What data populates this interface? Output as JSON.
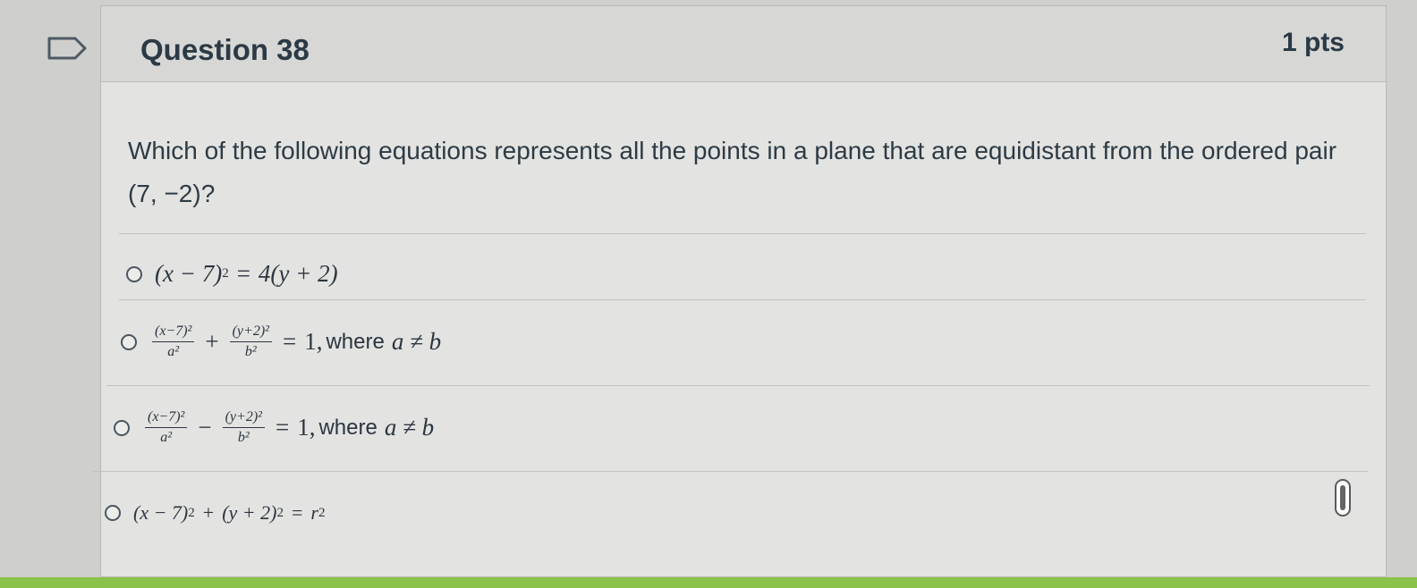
{
  "question": {
    "title": "Question 38",
    "points": "1 pts",
    "text": "Which of the following equations represents all the points in a plane that are equidistant from the ordered pair (7, −2)?"
  },
  "answers": [
    {
      "lhs": "(x − 7)",
      "lhs_exp": "2",
      "eq": "=",
      "rhs": "4(y + 2)"
    },
    {
      "f1_num": "(x−7)²",
      "f1_den": "a²",
      "op": "+",
      "f2_num": "(y+2)²",
      "f2_den": "b²",
      "eq": "=",
      "rhs": "1,",
      "where": "where",
      "cond": "a ≠ b"
    },
    {
      "f1_num": "(x−7)²",
      "f1_den": "a²",
      "op": "−",
      "f2_num": "(y+2)²",
      "f2_den": "b²",
      "eq": "=",
      "rhs": "1,",
      "where": "where",
      "cond": "a ≠ b"
    },
    {
      "t1": "(x − 7)",
      "t1_exp": "2",
      "op": "+",
      "t2": "(y + 2)",
      "t2_exp": "2",
      "eq": "=",
      "rhs": "r",
      "rhs_exp": "2"
    }
  ],
  "colors": {
    "accent_bar": "#8bc34a",
    "header_bg": "#d7d7d5",
    "card_bg": "#e3e3e1"
  }
}
